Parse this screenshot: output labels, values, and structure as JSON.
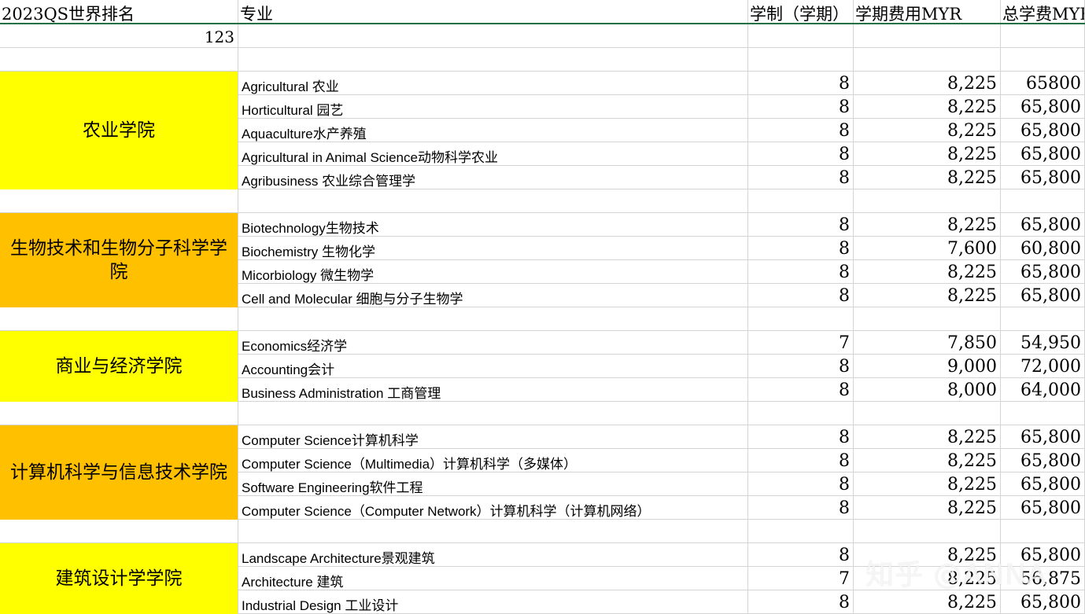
{
  "headers": {
    "rank": "2023QS世界排名",
    "major": "专业",
    "semesters": "学制（学期）",
    "fee": "学期费用MYR",
    "total": "总学费MYR"
  },
  "rank_value": "123",
  "schools": [
    {
      "name": "农业学院",
      "color": "#ffff00",
      "rows": [
        {
          "en": "Agricultural ",
          "zh": "农业",
          "sem": "8",
          "fee": "8,225",
          "total": "65800"
        },
        {
          "en": "Horticultural ",
          "zh": "园艺",
          "sem": "8",
          "fee": "8,225",
          "total": "65,800"
        },
        {
          "en": "Aquaculture",
          "zh": "水产养殖",
          "sem": "8",
          "fee": "8,225",
          "total": "65,800"
        },
        {
          "en": "Agricultural in Animal Science",
          "zh": "动物科学农业",
          "sem": "8",
          "fee": "8,225",
          "total": "65,800"
        },
        {
          "en": "Agribusiness ",
          "zh": "农业综合管理学",
          "sem": "8",
          "fee": "8,225",
          "total": "65,800"
        }
      ]
    },
    {
      "name": "生物技术和生物分子科学学院",
      "color": "#ffc000",
      "rows": [
        {
          "en": "Biotechnology",
          "zh": "生物技术",
          "sem": "8",
          "fee": "8,225",
          "total": "65,800"
        },
        {
          "en": "Biochemistry ",
          "zh": "生物化学",
          "sem": "8",
          "fee": "7,600",
          "total": "60,800"
        },
        {
          "en": "Micorbiology ",
          "zh": "微生物学",
          "sem": "8",
          "fee": "8,225",
          "total": "65,800"
        },
        {
          "en": "Cell and Molecular ",
          "zh": "细胞与分子生物学",
          "sem": "8",
          "fee": "8,225",
          "total": "65,800"
        }
      ]
    },
    {
      "name": "商业与经济学院",
      "color": "#ffff00",
      "rows": [
        {
          "en": "Economics",
          "zh": "经济学",
          "sem": "7",
          "fee": "7,850",
          "total": "54,950"
        },
        {
          "en": "Accounting",
          "zh": "会计",
          "sem": "8",
          "fee": "9,000",
          "total": "72,000"
        },
        {
          "en": "Business Administration ",
          "zh": "工商管理",
          "sem": "8",
          "fee": "8,000",
          "total": "64,000"
        }
      ]
    },
    {
      "name": "计算机科学与信息技术学院",
      "color": "#ffc000",
      "rows": [
        {
          "en": "Computer Science",
          "zh": "计算机科学",
          "sem": "8",
          "fee": "8,225",
          "total": "65,800"
        },
        {
          "en": "Computer Science（Multimedia）",
          "zh": "计算机科学（多媒体）",
          "sem": "8",
          "fee": "8,225",
          "total": "65,800"
        },
        {
          "en": "Software Engineering",
          "zh": "软件工程",
          "sem": "8",
          "fee": "8,225",
          "total": "65,800"
        },
        {
          "en": "Computer Science（Computer Network）",
          "zh": "计算机科学（计算机网络）",
          "sem": "8",
          "fee": "8,225",
          "total": "65,800"
        }
      ]
    },
    {
      "name": "建筑设计学学院",
      "color": "#ffff00",
      "rows": [
        {
          "en": "Landscape Architecture",
          "zh": "景观建筑",
          "sem": "8",
          "fee": "8,225",
          "total": "65,800"
        },
        {
          "en": "Architecture ",
          "zh": "建筑",
          "sem": "7",
          "fee": "8,225",
          "total": "56,875"
        },
        {
          "en": "Industrial Design ",
          "zh": "工业设计",
          "sem": "8",
          "fee": "8,225",
          "total": "65,800"
        }
      ]
    }
  ],
  "watermark": {
    "logo": "知乎",
    "handle": "@ANNA"
  }
}
